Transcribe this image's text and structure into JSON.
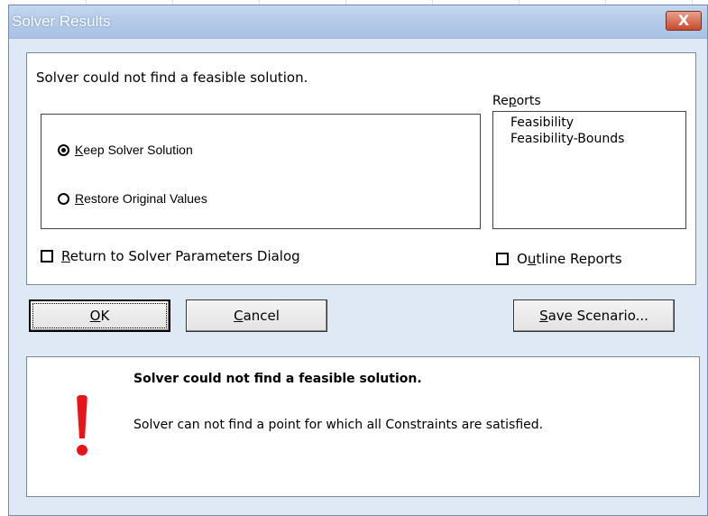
{
  "window": {
    "title": "Solver Results",
    "close_label": "X"
  },
  "message": "Solver could not find a feasible solution.",
  "options": {
    "keep": {
      "prefix": "",
      "accel": "K",
      "rest": "eep Solver Solution",
      "checked": true
    },
    "restore": {
      "prefix": "",
      "accel": "R",
      "rest": "estore Original Values",
      "checked": false
    }
  },
  "reports": {
    "label_prefix": "Re",
    "label_accel": "p",
    "label_rest": "orts",
    "items": [
      "Feasibility",
      "Feasibility-Bounds"
    ]
  },
  "return_checkbox": {
    "prefix": "",
    "accel": "R",
    "rest": "eturn to Solver Parameters Dialog",
    "checked": false
  },
  "outline_checkbox": {
    "prefix": "O",
    "accel": "u",
    "rest": "tline Reports",
    "checked": false
  },
  "buttons": {
    "ok": {
      "prefix": "",
      "accel": "O",
      "rest": "K"
    },
    "cancel": {
      "prefix": "",
      "accel": "C",
      "rest": "ancel"
    },
    "save": {
      "prefix": "",
      "accel": "S",
      "rest": "ave Scenario..."
    }
  },
  "result": {
    "title": "Solver could not find a feasible solution.",
    "detail": "Solver can not find a point for which all Constraints are satisfied.",
    "icon": "exclamation-icon",
    "icon_color": "#e8141a"
  },
  "colors": {
    "dialog_bg": "#dfe8f5",
    "titlebar": "#b3cae8",
    "close_button": "#c94a2b"
  }
}
